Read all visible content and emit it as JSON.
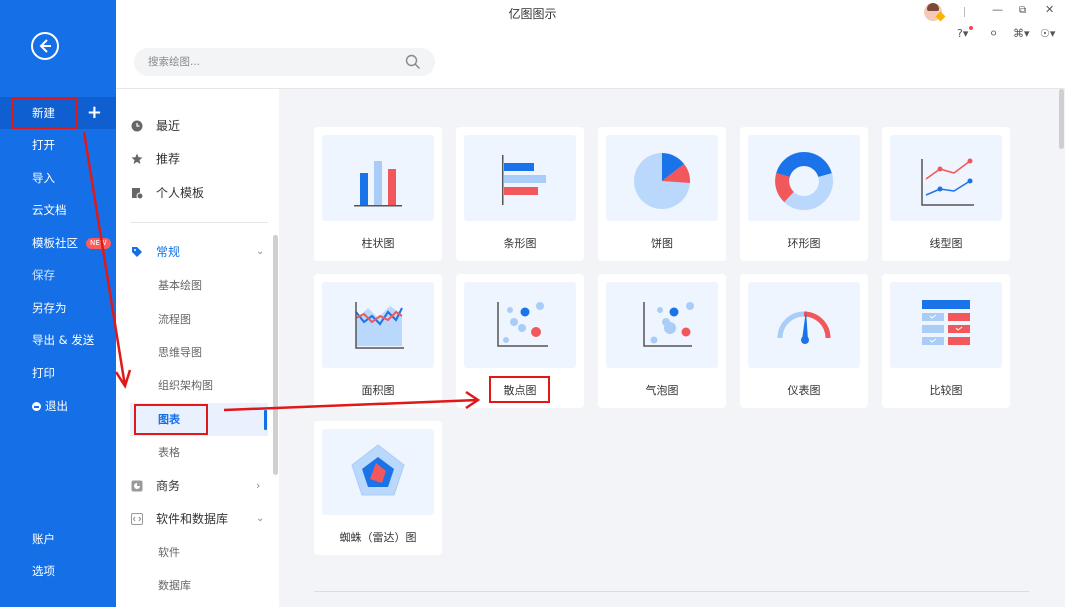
{
  "app": {
    "title": "亿图图示"
  },
  "sidebar": {
    "items": [
      {
        "id": "new",
        "label": "新建"
      },
      {
        "id": "open",
        "label": "打开"
      },
      {
        "id": "import",
        "label": "导入"
      },
      {
        "id": "cloud",
        "label": "云文档"
      },
      {
        "id": "template-community",
        "label": "模板社区",
        "badge": "NEW"
      },
      {
        "id": "save",
        "label": "保存"
      },
      {
        "id": "save-as",
        "label": "另存为"
      },
      {
        "id": "export-send",
        "label": "导出 & 发送"
      },
      {
        "id": "print",
        "label": "打印"
      },
      {
        "id": "exit",
        "label": "退出"
      }
    ],
    "bottom": [
      {
        "id": "account",
        "label": "账户"
      },
      {
        "id": "options",
        "label": "选项"
      }
    ]
  },
  "search": {
    "placeholder": "搜索绘图..."
  },
  "categories": {
    "top": [
      {
        "label": "最近",
        "icon": "clock-icon"
      },
      {
        "label": "推荐",
        "icon": "star-icon"
      },
      {
        "label": "个人模板",
        "icon": "personal-template-icon"
      }
    ],
    "general": {
      "label": "常规",
      "icon": "tag-icon"
    },
    "general_subs": [
      "基本绘图",
      "流程图",
      "思维导图",
      "组织架构图",
      "图表",
      "表格"
    ],
    "business": {
      "label": "商务",
      "icon": "business-icon"
    },
    "software": {
      "label": "软件和数据库",
      "icon": "code-icon"
    },
    "software_subs": [
      "软件",
      "数据库"
    ]
  },
  "charts": [
    {
      "label": "柱状图",
      "icon": "bar-chart-icon"
    },
    {
      "label": "条形图",
      "icon": "horizontal-bar-chart-icon"
    },
    {
      "label": "饼图",
      "icon": "pie-chart-icon"
    },
    {
      "label": "环形图",
      "icon": "donut-chart-icon"
    },
    {
      "label": "线型图",
      "icon": "line-chart-icon"
    },
    {
      "label": "面积图",
      "icon": "area-chart-icon"
    },
    {
      "label": "散点图",
      "icon": "scatter-chart-icon"
    },
    {
      "label": "气泡图",
      "icon": "bubble-chart-icon"
    },
    {
      "label": "仪表图",
      "icon": "gauge-chart-icon"
    },
    {
      "label": "比较图",
      "icon": "comparison-chart-icon"
    },
    {
      "label": "蜘蛛（雷达）图",
      "icon": "radar-chart-icon"
    }
  ],
  "colors": {
    "sidebar": "#1570e8",
    "accent": "#1570e8",
    "highlight": "#e01818",
    "chart_red": "#f2585b",
    "chart_blue": "#1a73e8",
    "chart_light": "#b9d8fb"
  }
}
